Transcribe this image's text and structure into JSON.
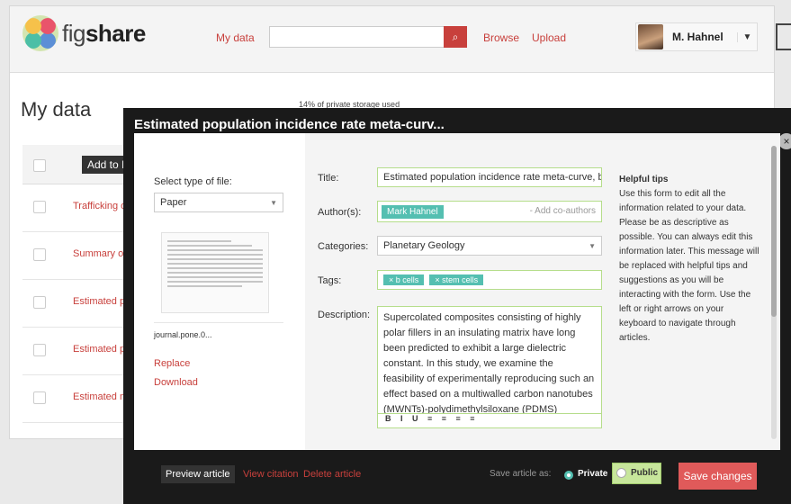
{
  "header": {
    "logo_text_light": "fig",
    "logo_text_bold": "share",
    "nav_mydata": "My data",
    "nav_browse": "Browse",
    "nav_upload": "Upload",
    "user_name": "M. Hahnel"
  },
  "page": {
    "title": "My data",
    "storage": "14% of private storage used",
    "add_to": "Add to I",
    "rows": [
      "Trafficking of",
      "Summary of s",
      "Estimated po",
      "Estimated po",
      "Estimated me"
    ]
  },
  "modal": {
    "title": "Estimated population incidence rate meta-curv...",
    "select_type_label": "Select type of file:",
    "file_type": "Paper",
    "file_name": "journal.pone.0...",
    "replace": "Replace",
    "download": "Download",
    "labels": {
      "title": "Title:",
      "authors": "Author(s):",
      "categories": "Categories:",
      "tags": "Tags:",
      "description": "Description:"
    },
    "title_value": "Estimated population incidence rate meta-curve, bas",
    "author": "Mark Hahnel",
    "add_coauthors": "- Add co-authors",
    "category": "Planetary Geology",
    "tags": [
      "b cells",
      "stem cells"
    ],
    "description": "Supercolated composites consisting of highly polar fillers in an insulating matrix have long been predicted to exhibit a large dielectric constant. In this study, we examine the feasibility of experimentally reproducing such an effect based on a multiwalled carbon nanotubes (MWNTs)-polydimethylsiloxane (PDMS) composite system. MWNTs of different diameters were subjected to high-power ultrasound.",
    "toolbar": "B I U ≡ ≡ ≡ ≡",
    "tips_title": "Helpful tips",
    "tips_body": "Use this form to edit all the information related to your data. Please be as descriptive as possible. You can always edit this information later. This message will be replaced with helpful tips and suggestions as you will be interacting with the form. Use the left or right arrows on your keyboard to navigate through articles.",
    "footer": {
      "preview": "Preview article",
      "view_citation": "View citation",
      "delete": "Delete article",
      "save_as": "Save article as:",
      "private": "Private",
      "public": "Public",
      "save": "Save changes"
    }
  }
}
